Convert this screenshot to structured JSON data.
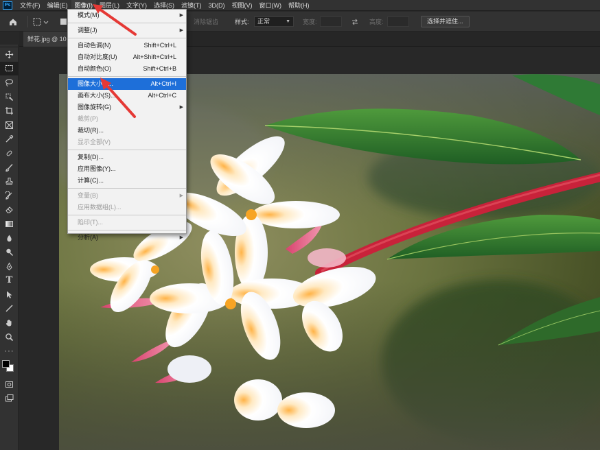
{
  "menubar": {
    "logo": "Ps",
    "items": [
      {
        "label": "文件(F)",
        "name": "menu-file"
      },
      {
        "label": "编辑(E)",
        "name": "menu-edit"
      },
      {
        "label": "图像(I)",
        "name": "menu-image"
      },
      {
        "label": "图层(L)",
        "name": "menu-layer"
      },
      {
        "label": "文字(Y)",
        "name": "menu-type"
      },
      {
        "label": "选择(S)",
        "name": "menu-select"
      },
      {
        "label": "滤镜(T)",
        "name": "menu-filter"
      },
      {
        "label": "3D(D)",
        "name": "menu-3d"
      },
      {
        "label": "视图(V)",
        "name": "menu-view"
      },
      {
        "label": "窗口(W)",
        "name": "menu-window"
      },
      {
        "label": "帮助(H)",
        "name": "menu-help"
      }
    ]
  },
  "options": {
    "antialias_label": "消除锯齿",
    "style_label": "样式:",
    "style_value": "正常",
    "width_label": "宽度:",
    "height_label": "高度:",
    "select_mask_button": "选择并遮住..."
  },
  "document": {
    "tab_label": "鲜花.jpg @ 10"
  },
  "image_menu": {
    "items": [
      {
        "label": "模式(M)",
        "shortcut": "",
        "submenu": true,
        "enabled": true
      },
      {
        "separator": true
      },
      {
        "label": "调整(J)",
        "shortcut": "",
        "submenu": true,
        "enabled": true
      },
      {
        "separator": true
      },
      {
        "label": "自动色调(N)",
        "shortcut": "Shift+Ctrl+L",
        "enabled": true
      },
      {
        "label": "自动对比度(U)",
        "shortcut": "Alt+Shift+Ctrl+L",
        "enabled": true
      },
      {
        "label": "自动颜色(O)",
        "shortcut": "Shift+Ctrl+B",
        "enabled": true
      },
      {
        "separator": true
      },
      {
        "label": "图像大小(I)...",
        "shortcut": "Alt+Ctrl+I",
        "enabled": true,
        "highlighted": true
      },
      {
        "label": "画布大小(S)...",
        "shortcut": "Alt+Ctrl+C",
        "enabled": true
      },
      {
        "label": "图像旋转(G)",
        "shortcut": "",
        "submenu": true,
        "enabled": true
      },
      {
        "label": "裁剪(P)",
        "shortcut": "",
        "enabled": false
      },
      {
        "label": "裁切(R)...",
        "shortcut": "",
        "enabled": true
      },
      {
        "label": "显示全部(V)",
        "shortcut": "",
        "enabled": false
      },
      {
        "separator": true
      },
      {
        "label": "复制(D)...",
        "shortcut": "",
        "enabled": true
      },
      {
        "label": "应用图像(Y)...",
        "shortcut": "",
        "enabled": true
      },
      {
        "label": "计算(C)...",
        "shortcut": "",
        "enabled": true
      },
      {
        "separator": true
      },
      {
        "label": "变量(B)",
        "shortcut": "",
        "submenu": true,
        "enabled": false
      },
      {
        "label": "应用数据组(L)...",
        "shortcut": "",
        "enabled": false
      },
      {
        "separator": true
      },
      {
        "label": "陷印(T)...",
        "shortcut": "",
        "enabled": false
      },
      {
        "separator": true
      },
      {
        "label": "分析(A)",
        "shortcut": "",
        "submenu": true,
        "enabled": true
      }
    ]
  },
  "tools": [
    "move-tool",
    "marquee-tool",
    "lasso-tool",
    "quick-select-tool",
    "crop-tool",
    "frame-tool",
    "eyedropper-tool",
    "healing-brush-tool",
    "brush-tool",
    "clone-stamp-tool",
    "history-brush-tool",
    "eraser-tool",
    "gradient-tool",
    "blur-tool",
    "dodge-tool",
    "pen-tool",
    "type-tool",
    "path-select-tool",
    "line-tool",
    "hand-tool",
    "zoom-tool",
    "edit-toolbar",
    "quick-mask-mode",
    "screen-mode"
  ],
  "colors": {
    "menu_highlight": "#1e6fd9",
    "annotation_arrow": "#e53935",
    "foreground": "#000000",
    "background": "#ffffff"
  }
}
